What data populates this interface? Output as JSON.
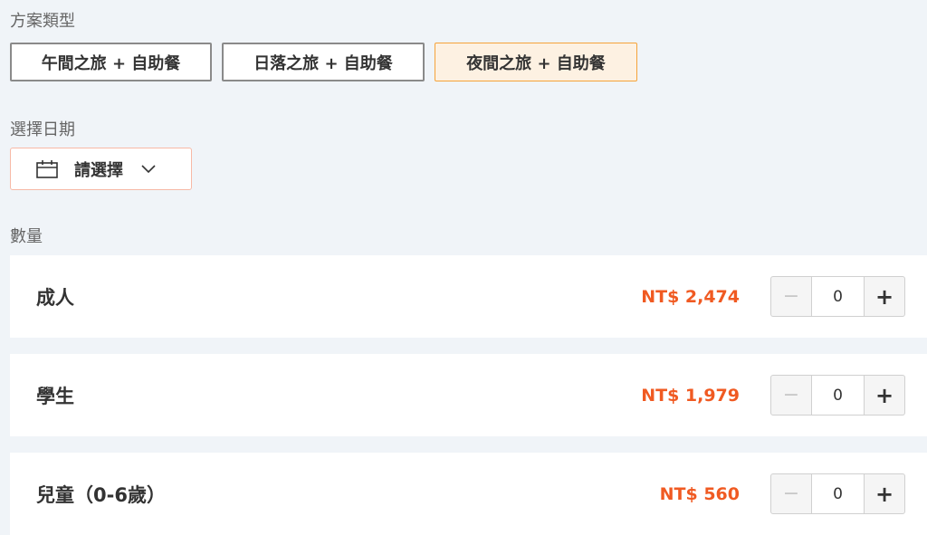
{
  "plan_type": {
    "label": "方案類型",
    "options": [
      {
        "label": "午間之旅 + 自助餐",
        "selected": false
      },
      {
        "label": "日落之旅 + 自助餐",
        "selected": false
      },
      {
        "label": "夜間之旅 + 自助餐",
        "selected": true
      }
    ]
  },
  "date": {
    "label": "選擇日期",
    "placeholder": "請選擇",
    "icon": "calendar-icon"
  },
  "quantity": {
    "label": "數量",
    "rows": [
      {
        "name": "成人",
        "price": "NT$ 2,474",
        "qty": "0",
        "minus": "−",
        "plus": "+"
      },
      {
        "name": "學生",
        "price": "NT$ 1,979",
        "qty": "0",
        "minus": "−",
        "plus": "+"
      },
      {
        "name": "兒童（0-6歲）",
        "price": "NT$ 560",
        "qty": "0",
        "minus": "−",
        "plus": "+"
      }
    ]
  },
  "colors": {
    "price": "#f05a22",
    "selected_border": "#f5a33a",
    "selected_bg": "#fdf1e2",
    "page_bg": "#f0f4f8"
  }
}
